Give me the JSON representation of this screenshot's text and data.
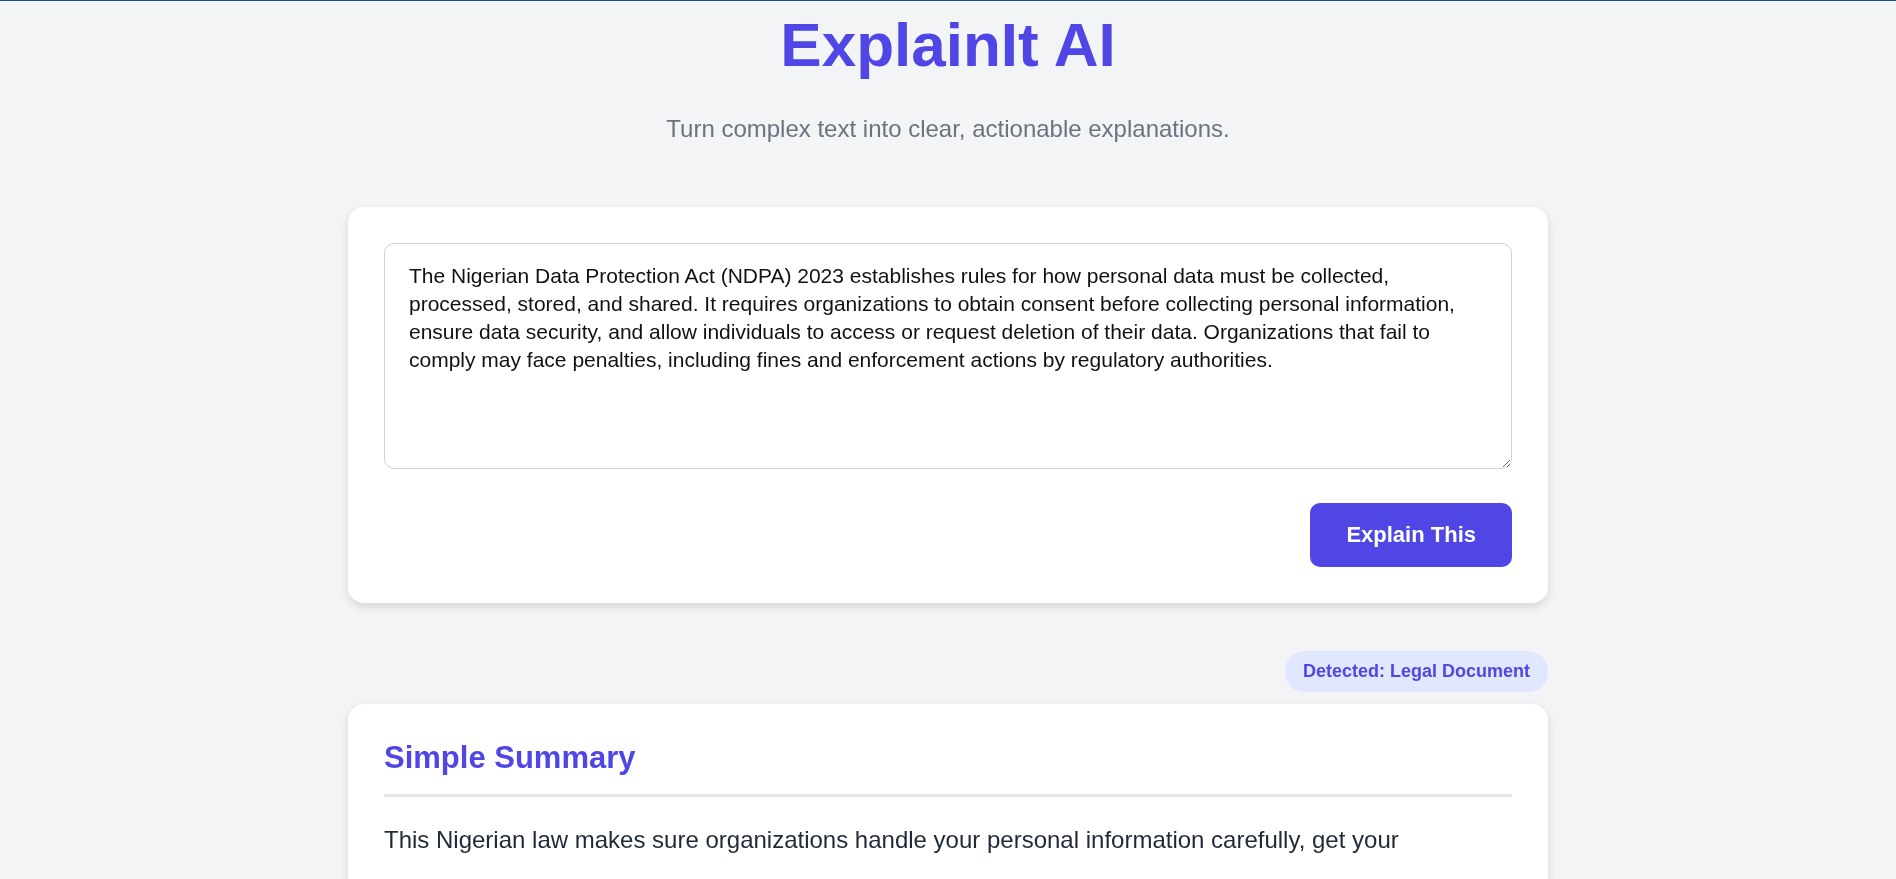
{
  "header": {
    "title": "ExplainIt AI",
    "subtitle": "Turn complex text into clear, actionable explanations."
  },
  "input_card": {
    "text": "The Nigerian Data Protection Act (NDPA) 2023 establishes rules for how personal data must be collected, processed, stored, and shared. It requires organizations to obtain consent before collecting personal information, ensure data security, and allow individuals to access or request deletion of their data. Organizations that fail to comply may face penalties, including fines and enforcement actions by regulatory authorities.",
    "button": "Explain This"
  },
  "detected_badge": "Detected: Legal Document",
  "result_card": {
    "heading": "Simple Summary",
    "text": "This Nigerian law makes sure organizations handle your personal information carefully, get your"
  }
}
